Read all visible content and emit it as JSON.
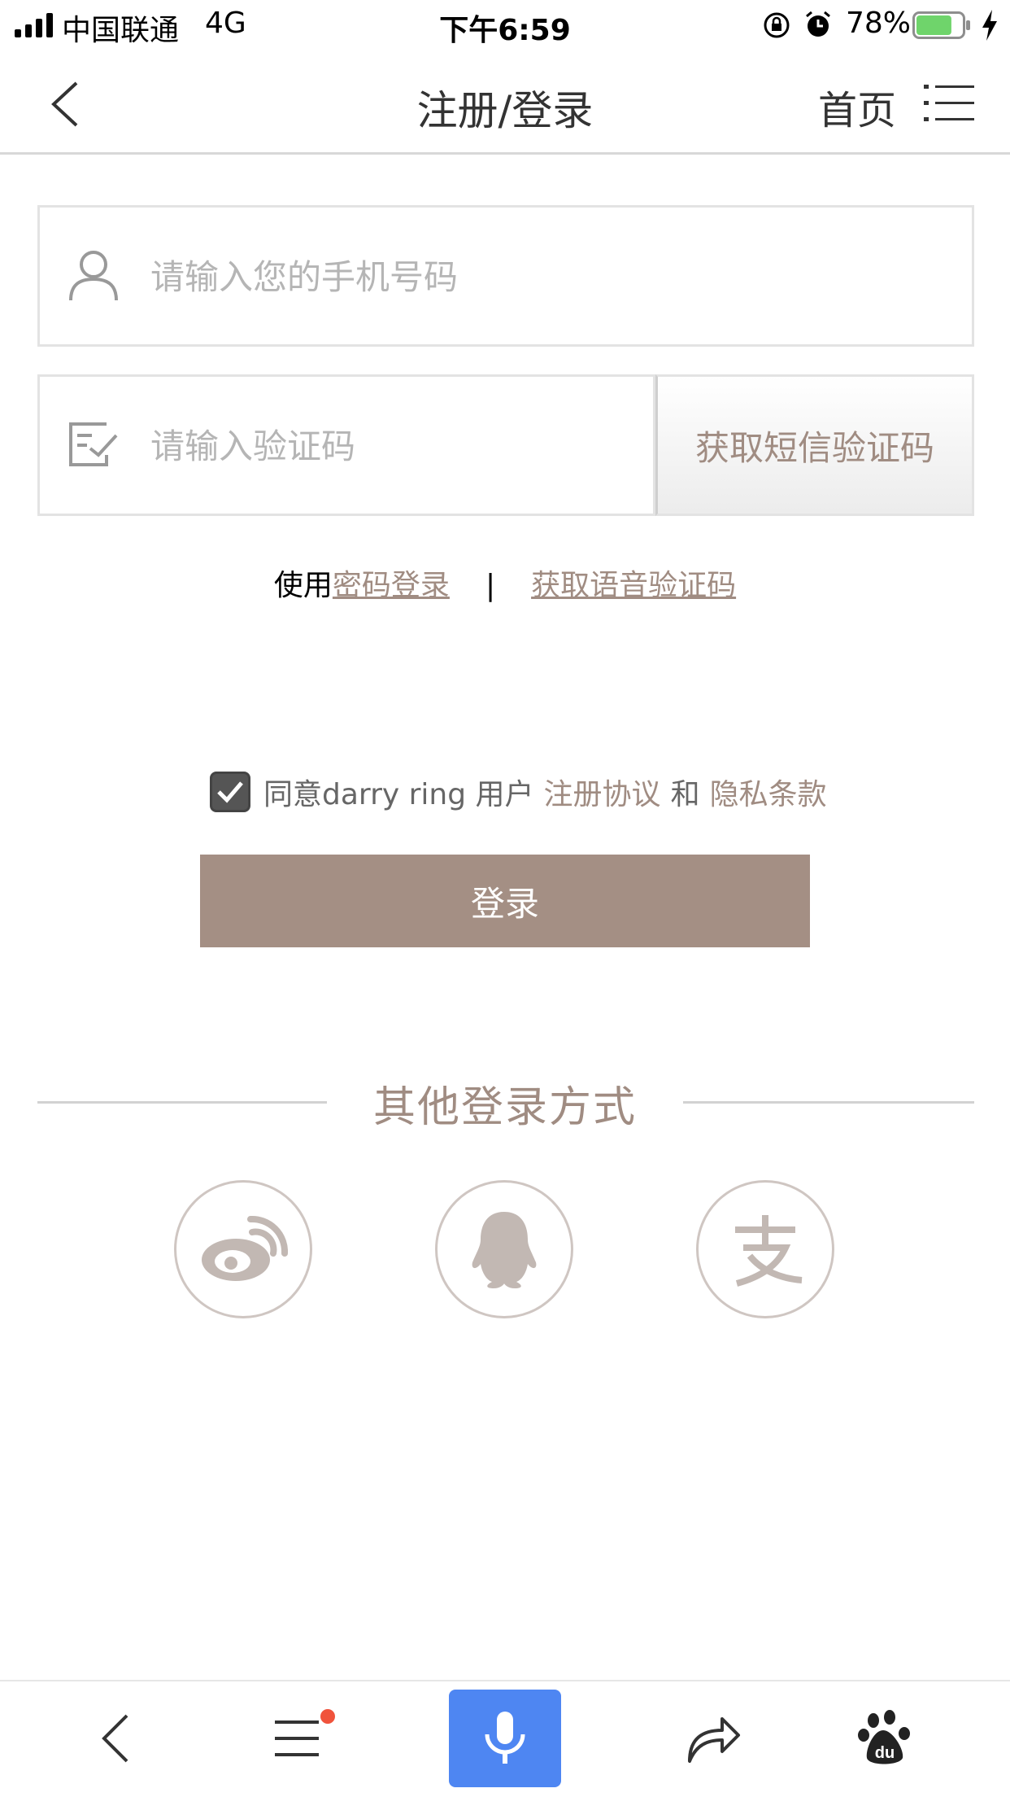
{
  "status_bar": {
    "carrier": "中国联通",
    "network": "4G",
    "time": "下午6:59",
    "battery_percent": "78%",
    "battery_level": 0.78,
    "colors": {
      "battery_fill": "#6fd46b"
    }
  },
  "nav": {
    "title": "注册/登录",
    "home_label": "首页",
    "icons": [
      "chevron-left-icon",
      "menu-icon"
    ]
  },
  "form": {
    "phone_placeholder": "请输入您的手机号码",
    "code_placeholder": "请输入验证码",
    "sms_button_label": "获取短信验证码"
  },
  "alt_login": {
    "prefix": "使用",
    "password_link": "密码登录",
    "separator": "|",
    "voice_link": "获取语音验证码"
  },
  "agreement": {
    "checked": true,
    "text_prefix": "同意darry ring 用户",
    "terms_link": "注册协议",
    "conjunction": "和",
    "privacy_link": "隐私条款"
  },
  "login_button_label": "登录",
  "other_login": {
    "title": "其他登录方式",
    "providers": [
      "weibo-icon",
      "qq-icon",
      "alipay-icon"
    ]
  },
  "colors": {
    "accent": "#a48f84",
    "accent_text": "#a08c82",
    "browser_blue": "#4e86f2"
  },
  "toolbar": {
    "icons": [
      "back-icon",
      "menu-icon",
      "microphone-icon",
      "share-icon",
      "baidu-paw-icon"
    ],
    "menu_has_notification": true
  }
}
